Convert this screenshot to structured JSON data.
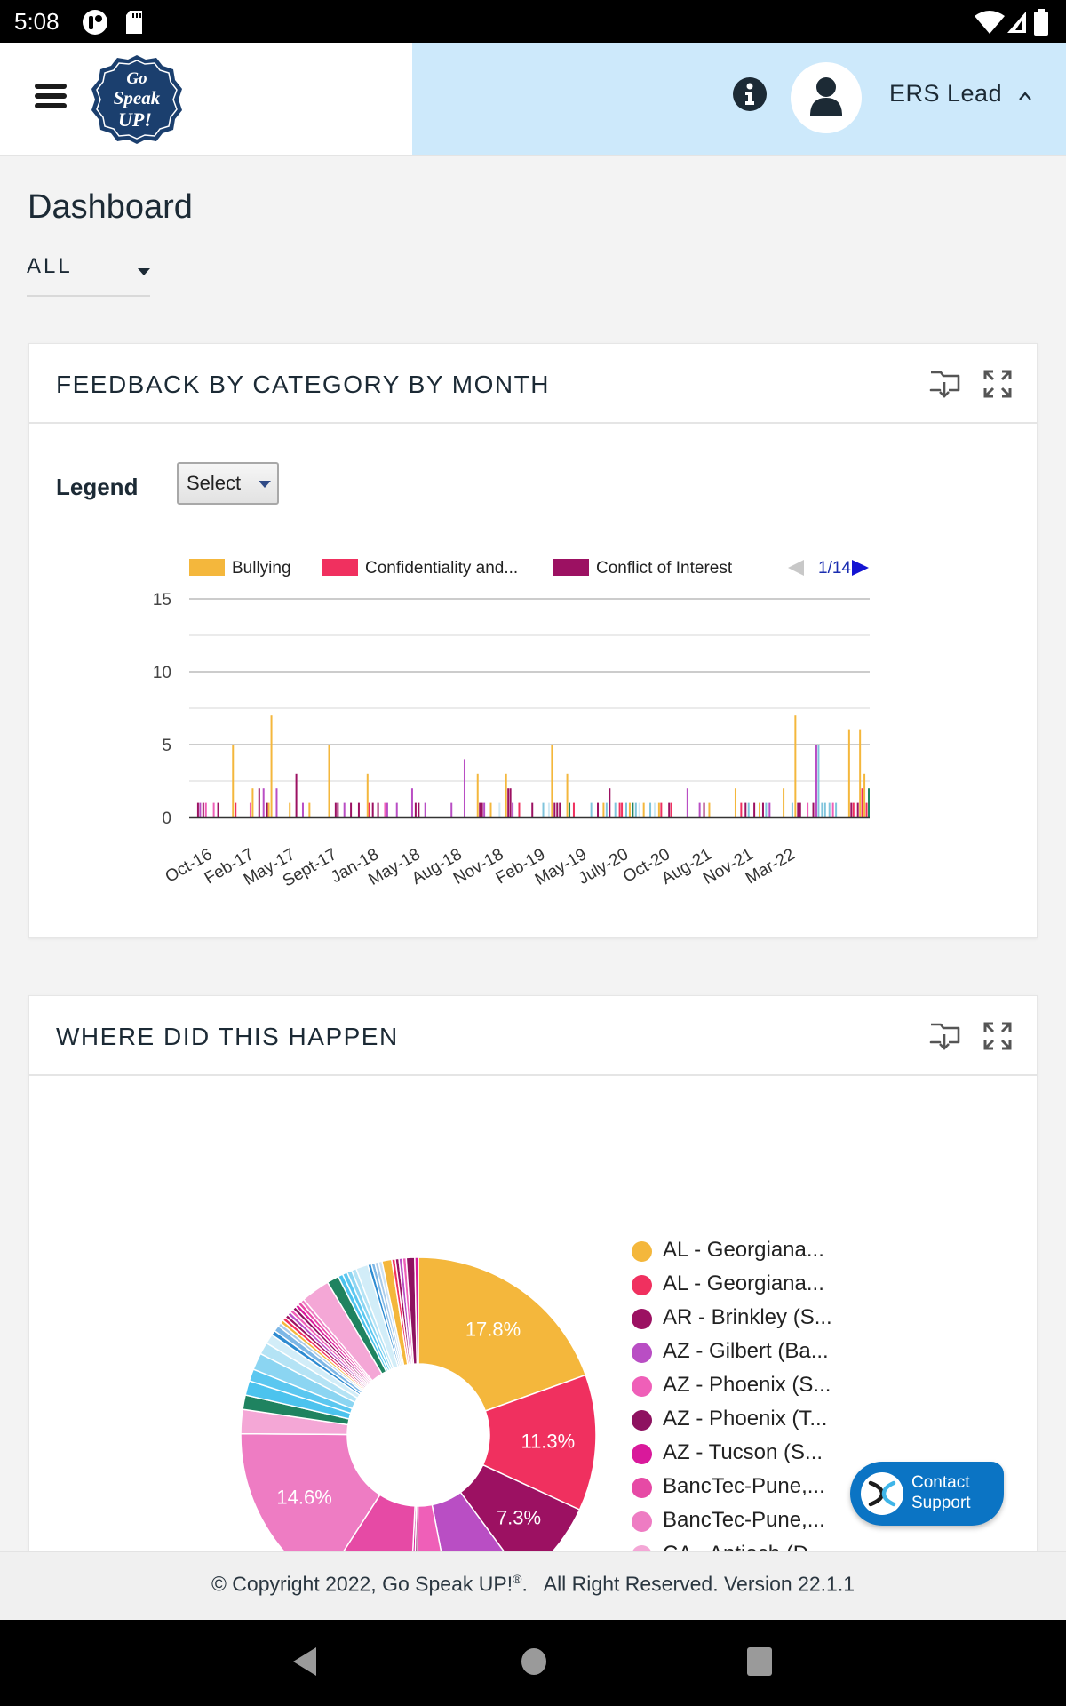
{
  "status_bar": {
    "time": "5:08",
    "icons": [
      "app-notification-icon",
      "sd-card-icon",
      "wifi-icon",
      "signal-icon",
      "battery-icon"
    ]
  },
  "header": {
    "menu_icon": "hamburger-menu-icon",
    "logo_text": [
      "Go",
      "Speak",
      "UP!"
    ],
    "info_icon": "info-icon",
    "avatar_icon": "user-icon",
    "user_name": "ERS Lead",
    "user_menu_icon": "chevron-up-icon"
  },
  "page": {
    "title": "Dashboard",
    "scope_select": {
      "value": "ALL"
    }
  },
  "card_feedback": {
    "title": "FEEDBACK BY CATEGORY BY MONTH",
    "download_icon": "folder-download-icon",
    "expand_icon": "expand-icon",
    "legend_label": "Legend",
    "legend_select": {
      "value": "Select"
    }
  },
  "card_location": {
    "title": "WHERE DID THIS HAPPEN",
    "download_icon": "folder-download-icon",
    "expand_icon": "expand-icon"
  },
  "chart_data": [
    {
      "type": "bar",
      "title": "FEEDBACK BY CATEGORY BY MONTH",
      "xlabel": "",
      "ylabel": "",
      "ylim": [
        0,
        15
      ],
      "yticks": [
        0,
        5,
        10,
        15
      ],
      "grid": true,
      "legend_position": "top",
      "legend": {
        "entries": [
          {
            "name": "Bullying",
            "color": "#f4b73c"
          },
          {
            "name": "Confidentiality and...",
            "color": "#f0305f"
          },
          {
            "name": "Conflict of Interest",
            "color": "#9c1162"
          }
        ],
        "page": "1/14"
      },
      "categories": [
        "Oct-16",
        "Feb-17",
        "May-17",
        "Sept-17",
        "Jan-18",
        "May-18",
        "Aug-18",
        "Nov-18",
        "Feb-19",
        "May-19",
        "July-20",
        "Oct-20",
        "Aug-21",
        "Nov-21",
        "Mar-22"
      ],
      "series_colors": [
        "#f4b73c",
        "#f0305f",
        "#9c1162",
        "#b94ec4",
        "#ef5fb8",
        "#e23a9e",
        "#7fc4dc",
        "#1f8360",
        "#cfe9f4"
      ],
      "bars": [
        {
          "x": 0.01,
          "v": 1,
          "c": 2
        },
        {
          "x": 0.015,
          "v": 1,
          "c": 3
        },
        {
          "x": 0.022,
          "v": 1,
          "c": 2
        },
        {
          "x": 0.028,
          "v": 1,
          "c": 4
        },
        {
          "x": 0.046,
          "v": 1,
          "c": 4
        },
        {
          "x": 0.056,
          "v": 1,
          "c": 2
        },
        {
          "x": 0.09,
          "v": 5,
          "c": 0
        },
        {
          "x": 0.096,
          "v": 1,
          "c": 1
        },
        {
          "x": 0.13,
          "v": 1,
          "c": 4
        },
        {
          "x": 0.135,
          "v": 2,
          "c": 0
        },
        {
          "x": 0.15,
          "v": 2,
          "c": 2
        },
        {
          "x": 0.16,
          "v": 2,
          "c": 3
        },
        {
          "x": 0.168,
          "v": 1,
          "c": 2
        },
        {
          "x": 0.172,
          "v": 1,
          "c": 0
        },
        {
          "x": 0.178,
          "v": 7,
          "c": 0
        },
        {
          "x": 0.19,
          "v": 2,
          "c": 3
        },
        {
          "x": 0.22,
          "v": 1,
          "c": 0
        },
        {
          "x": 0.235,
          "v": 3,
          "c": 2
        },
        {
          "x": 0.25,
          "v": 1,
          "c": 3
        },
        {
          "x": 0.265,
          "v": 1,
          "c": 0
        },
        {
          "x": 0.31,
          "v": 5,
          "c": 0
        },
        {
          "x": 0.325,
          "v": 1,
          "c": 2
        },
        {
          "x": 0.33,
          "v": 1,
          "c": 2
        },
        {
          "x": 0.345,
          "v": 1,
          "c": 3
        },
        {
          "x": 0.36,
          "v": 1,
          "c": 2
        },
        {
          "x": 0.378,
          "v": 1,
          "c": 2
        },
        {
          "x": 0.398,
          "v": 3,
          "c": 0
        },
        {
          "x": 0.402,
          "v": 1,
          "c": 1
        },
        {
          "x": 0.41,
          "v": 1,
          "c": 2
        },
        {
          "x": 0.422,
          "v": 1,
          "c": 2
        },
        {
          "x": 0.438,
          "v": 1,
          "c": 4
        },
        {
          "x": 0.443,
          "v": 1,
          "c": 3
        },
        {
          "x": 0.465,
          "v": 1,
          "c": 3
        },
        {
          "x": 0.5,
          "v": 2,
          "c": 3
        },
        {
          "x": 0.508,
          "v": 1,
          "c": 2
        },
        {
          "x": 0.515,
          "v": 1,
          "c": 2
        },
        {
          "x": 0.53,
          "v": 1,
          "c": 3
        },
        {
          "x": 0.59,
          "v": 1,
          "c": 3
        },
        {
          "x": 0.62,
          "v": 4,
          "c": 3
        },
        {
          "x": 0.65,
          "v": 3,
          "c": 0
        },
        {
          "x": 0.655,
          "v": 1,
          "c": 2
        },
        {
          "x": 0.66,
          "v": 1,
          "c": 2
        },
        {
          "x": 0.665,
          "v": 1,
          "c": 3
        },
        {
          "x": 0.68,
          "v": 1,
          "c": 0
        },
        {
          "x": 0.7,
          "v": 1,
          "c": 8
        },
        {
          "x": 0.715,
          "v": 3,
          "c": 0
        },
        {
          "x": 0.72,
          "v": 2,
          "c": 2
        },
        {
          "x": 0.725,
          "v": 2,
          "c": 2
        },
        {
          "x": 0.73,
          "v": 1,
          "c": 3
        },
        {
          "x": 0.745,
          "v": 1,
          "c": 1
        },
        {
          "x": 0.775,
          "v": 1,
          "c": 2
        },
        {
          "x": 0.8,
          "v": 1,
          "c": 6
        },
        {
          "x": 0.813,
          "v": 1,
          "c": 8
        },
        {
          "x": 0.82,
          "v": 5,
          "c": 0
        },
        {
          "x": 0.826,
          "v": 1,
          "c": 2
        },
        {
          "x": 0.832,
          "v": 1,
          "c": 2
        },
        {
          "x": 0.838,
          "v": 1,
          "c": 2
        },
        {
          "x": 0.855,
          "v": 3,
          "c": 0
        },
        {
          "x": 0.86,
          "v": 1,
          "c": 7
        },
        {
          "x": 0.87,
          "v": 1,
          "c": 1
        },
        {
          "x": 0.91,
          "v": 1,
          "c": 6
        },
        {
          "x": 0.925,
          "v": 1,
          "c": 2
        },
        {
          "x": 0.938,
          "v": 1,
          "c": 0
        },
        {
          "x": 0.945,
          "v": 1,
          "c": 6
        },
        {
          "x": 0.952,
          "v": 2,
          "c": 2
        },
        {
          "x": 0.965,
          "v": 1,
          "c": 6
        },
        {
          "x": 0.975,
          "v": 1,
          "c": 1
        },
        {
          "x": 0.98,
          "v": 1,
          "c": 1
        },
        {
          "x": 0.99,
          "v": 1,
          "c": 6
        },
        {
          "x": 0.998,
          "v": 1,
          "c": 0
        },
        {
          "x": 1.005,
          "v": 1,
          "c": 7
        },
        {
          "x": 1.012,
          "v": 1,
          "c": 6
        },
        {
          "x": 1.02,
          "v": 1,
          "c": 8
        },
        {
          "x": 1.03,
          "v": 1,
          "c": 0
        },
        {
          "x": 1.045,
          "v": 1,
          "c": 6
        },
        {
          "x": 1.055,
          "v": 1,
          "c": 8
        },
        {
          "x": 1.065,
          "v": 1,
          "c": 0
        },
        {
          "x": 1.07,
          "v": 1,
          "c": 1
        },
        {
          "x": 1.088,
          "v": 1,
          "c": 2
        },
        {
          "x": 1.093,
          "v": 1,
          "c": 1
        },
        {
          "x": 1.13,
          "v": 2,
          "c": 3
        },
        {
          "x": 1.158,
          "v": 1,
          "c": 3
        },
        {
          "x": 1.168,
          "v": 1,
          "c": 2
        },
        {
          "x": 1.18,
          "v": 1,
          "c": 0
        },
        {
          "x": 1.24,
          "v": 2,
          "c": 0
        },
        {
          "x": 1.253,
          "v": 1,
          "c": 1
        },
        {
          "x": 1.263,
          "v": 1,
          "c": 2
        },
        {
          "x": 1.27,
          "v": 1,
          "c": 6
        },
        {
          "x": 1.283,
          "v": 1,
          "c": 2
        },
        {
          "x": 1.295,
          "v": 1,
          "c": 0
        },
        {
          "x": 1.303,
          "v": 1,
          "c": 2
        },
        {
          "x": 1.31,
          "v": 1,
          "c": 6
        },
        {
          "x": 1.318,
          "v": 1,
          "c": 3
        },
        {
          "x": 1.35,
          "v": 2,
          "c": 0
        },
        {
          "x": 1.37,
          "v": 1,
          "c": 6
        },
        {
          "x": 1.377,
          "v": 7,
          "c": 0
        },
        {
          "x": 1.383,
          "v": 1,
          "c": 2
        },
        {
          "x": 1.388,
          "v": 1,
          "c": 2
        },
        {
          "x": 1.405,
          "v": 1,
          "c": 4
        },
        {
          "x": 1.418,
          "v": 1,
          "c": 2
        },
        {
          "x": 1.425,
          "v": 5,
          "c": 3
        },
        {
          "x": 1.43,
          "v": 5,
          "c": 6
        },
        {
          "x": 1.438,
          "v": 1,
          "c": 6
        },
        {
          "x": 1.445,
          "v": 1,
          "c": 6
        },
        {
          "x": 1.455,
          "v": 1,
          "c": 6
        },
        {
          "x": 1.463,
          "v": 1,
          "c": 4
        },
        {
          "x": 1.47,
          "v": 1,
          "c": 6
        },
        {
          "x": 1.5,
          "v": 6,
          "c": 0
        },
        {
          "x": 1.505,
          "v": 1,
          "c": 2
        },
        {
          "x": 1.51,
          "v": 1,
          "c": 1
        },
        {
          "x": 1.52,
          "v": 1,
          "c": 2
        },
        {
          "x": 1.525,
          "v": 6,
          "c": 0
        },
        {
          "x": 1.53,
          "v": 2,
          "c": 1
        },
        {
          "x": 1.535,
          "v": 3,
          "c": 0
        },
        {
          "x": 1.54,
          "v": 1,
          "c": 1
        },
        {
          "x": 1.545,
          "v": 2,
          "c": 7
        }
      ]
    },
    {
      "type": "pie",
      "title": "WHERE DID THIS HAPPEN",
      "donut": true,
      "legend_position": "right",
      "legend_entries": [
        {
          "name": "AL - Georgiana...",
          "color": "#f4b73c"
        },
        {
          "name": "AL - Georgiana...",
          "color": "#f0305f"
        },
        {
          "name": "AR - Brinkley (S...",
          "color": "#9c1162"
        },
        {
          "name": "AZ - Gilbert (Ba...",
          "color": "#b94ec4"
        },
        {
          "name": "AZ - Phoenix (S...",
          "color": "#ef5fb8"
        },
        {
          "name": "AZ - Phoenix (T...",
          "color": "#8e1260"
        },
        {
          "name": "AZ - Tucson (S...",
          "color": "#d9199b"
        },
        {
          "name": "BancTec-Pune,...",
          "color": "#e64aa5"
        },
        {
          "name": "BancTec-Pune,...",
          "color": "#ee7cc3"
        },
        {
          "name": "CA - Antioch (D...",
          "color": "#f4a7d6"
        }
      ],
      "slices": [
        {
          "value": 17.8,
          "color": "#f4b73c",
          "label": "17.8%"
        },
        {
          "value": 11.3,
          "color": "#f0305f",
          "label": "11.3%"
        },
        {
          "value": 7.3,
          "color": "#9c1162",
          "label": "7.3%"
        },
        {
          "value": 6.4,
          "color": "#b94ec4",
          "label": ""
        },
        {
          "value": 2.9,
          "color": "#ef5fb8",
          "label": ""
        },
        {
          "value": 0.3,
          "color": "#8e1260",
          "label": ""
        },
        {
          "value": 0.3,
          "color": "#d9199b",
          "label": ""
        },
        {
          "value": 7.6,
          "color": "#e64aa5",
          "label": ""
        },
        {
          "value": 14.6,
          "color": "#ee7cc3",
          "label": "14.6%"
        },
        {
          "value": 2.0,
          "color": "#f4a7d6",
          "label": ""
        },
        {
          "value": 1.2,
          "color": "#1f8360",
          "label": ""
        },
        {
          "value": 1.2,
          "color": "#4cc3ee",
          "label": ""
        },
        {
          "value": 1.0,
          "color": "#5bc7f0",
          "label": ""
        },
        {
          "value": 1.4,
          "color": "#8bd5f2",
          "label": ""
        },
        {
          "value": 1.0,
          "color": "#b4e3f5",
          "label": ""
        },
        {
          "value": 0.8,
          "color": "#d2edf8",
          "label": ""
        },
        {
          "value": 0.4,
          "color": "#2d8bd1",
          "label": ""
        },
        {
          "value": 0.5,
          "color": "#7db7e6",
          "label": ""
        },
        {
          "value": 0.3,
          "color": "#a9cbe9",
          "label": ""
        },
        {
          "value": 0.3,
          "color": "#f4b73c",
          "label": ""
        },
        {
          "value": 0.3,
          "color": "#f0305f",
          "label": ""
        },
        {
          "value": 0.3,
          "color": "#9c1162",
          "label": ""
        },
        {
          "value": 0.3,
          "color": "#b94ec4",
          "label": ""
        },
        {
          "value": 0.3,
          "color": "#ef5fb8",
          "label": ""
        },
        {
          "value": 0.3,
          "color": "#8e1260",
          "label": ""
        },
        {
          "value": 0.3,
          "color": "#d9199b",
          "label": ""
        },
        {
          "value": 0.3,
          "color": "#e64aa5",
          "label": ""
        },
        {
          "value": 0.3,
          "color": "#ee7cc3",
          "label": ""
        },
        {
          "value": 2.4,
          "color": "#f4a7d6",
          "label": ""
        },
        {
          "value": 1.0,
          "color": "#1f8360",
          "label": ""
        },
        {
          "value": 0.4,
          "color": "#4cc3ee",
          "label": ""
        },
        {
          "value": 0.4,
          "color": "#5bc7f0",
          "label": ""
        },
        {
          "value": 0.4,
          "color": "#8bd5f2",
          "label": ""
        },
        {
          "value": 0.4,
          "color": "#b4e3f5",
          "label": ""
        },
        {
          "value": 1.0,
          "color": "#d2edf8",
          "label": ""
        },
        {
          "value": 0.3,
          "color": "#2d8bd1",
          "label": ""
        },
        {
          "value": 0.3,
          "color": "#7db7e6",
          "label": ""
        },
        {
          "value": 0.3,
          "color": "#a9cbe9",
          "label": ""
        },
        {
          "value": 0.3,
          "color": "#cfe3f3",
          "label": ""
        },
        {
          "value": 0.8,
          "color": "#f4b73c",
          "label": ""
        },
        {
          "value": 0.3,
          "color": "#f0305f",
          "label": ""
        },
        {
          "value": 0.3,
          "color": "#9c1162",
          "label": ""
        },
        {
          "value": 0.3,
          "color": "#b94ec4",
          "label": ""
        },
        {
          "value": 0.3,
          "color": "#ef5fb8",
          "label": ""
        },
        {
          "value": 0.7,
          "color": "#8e1260",
          "label": ""
        },
        {
          "value": 0.3,
          "color": "#d9199b",
          "label": ""
        }
      ]
    }
  ],
  "contact_support": {
    "label_line1": "Contact",
    "label_line2": "Support"
  },
  "footer": {
    "copyright": "© Copyright 2022, Go Speak UP!",
    "registered": "®",
    "rest": ".   All Right Reserved. Version 22.1.1"
  },
  "nav_bar": {
    "buttons": [
      "back-icon",
      "home-icon",
      "recents-icon"
    ]
  }
}
